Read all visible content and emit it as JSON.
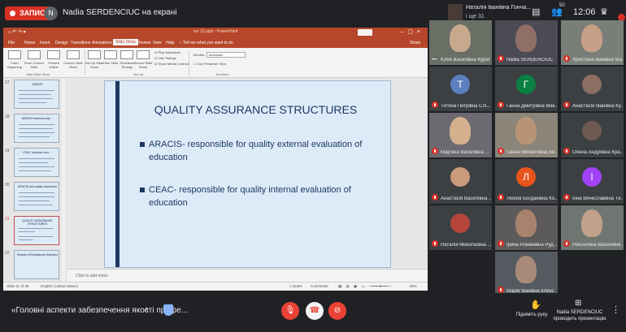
{
  "topbar": {
    "rec_label": "ЗАПИС",
    "presenter_initial": "N",
    "presenter_title": "Nadia SERDENCIUC на екрані",
    "pinned_name": "Наталія Іванівна Гонча...",
    "pinned_sub": "і ще 31",
    "participants_count": "50",
    "time": "12:06"
  },
  "ppt": {
    "file_title": "ver 22.pptx - PowerPoint",
    "quick_access": "⌂ ↶ ↷ ▾",
    "tabs": [
      "File",
      "Home",
      "Insert",
      "Design",
      "Transitions",
      "Animations",
      "Slide Show",
      "Review",
      "View",
      "Help",
      "♀ Tell me what you want to do"
    ],
    "share": "Share",
    "active_tab_index": 6,
    "ribbon_buttons": [
      "From Beginning",
      "From Current Slide",
      "Present Online",
      "Custom Slide Show",
      "Set Up Slide Show",
      "Hide Slide",
      "Rehearse Timings",
      "Record Slide Show"
    ],
    "ribbon_checks": [
      "Play Narrations",
      "Use Timings",
      "Show Media Controls"
    ],
    "monitor_label": "Monitor:",
    "monitor_value": "Automatic",
    "presenter_view": "Use Presenter View",
    "groups": [
      "Start Slide Show",
      "Set Up",
      "Monitors"
    ],
    "thumbs": [
      {
        "num": "17",
        "title": "ARACIS"
      },
      {
        "num": "18",
        "title": "ARACIS functions and ..."
      },
      {
        "num": "19",
        "title": "CEAC functions and ..."
      },
      {
        "num": "20",
        "title": "ARACIS and quality assurance"
      },
      {
        "num": "21",
        "title": "QUALITY ASSURANCE STRUCTURES"
      },
      {
        "num": "22",
        "title": "Results of Educational Sciences"
      }
    ],
    "selected_thumb": 4,
    "slide": {
      "title": "QUALITY ASSURANCE STRUCTURES",
      "bullets": [
        "ARACIS- responsible for quality external evaluation of education",
        "CEAC- responsible for quality internal evaluation of education"
      ]
    },
    "notes_placeholder": "Click to add notes",
    "status_slide": "Slide 21 of 38",
    "status_lang": "English (United States)",
    "status_notes": "≡ Notes",
    "status_comments": "Comments",
    "status_zoom": "60%"
  },
  "participants": [
    {
      "name": "Юлія Василівна Курій",
      "kind": "video",
      "bg": "#6a6f66",
      "face": "#c9a98e",
      "menu": true
    },
    {
      "name": "Nadia SERDENCIUC",
      "kind": "video",
      "bg": "#4b4a55",
      "face": "#8f6f66",
      "menu": false
    },
    {
      "name": "Христина Іванівна Ма...",
      "kind": "video",
      "bg": "#7a7e78",
      "face": "#c79e86",
      "menu": false
    },
    {
      "name": "Тетяна Петрівна Слі...",
      "kind": "letter",
      "letter": "Т",
      "color": "#5b7fbf",
      "menu": false
    },
    {
      "name": "Ганна Дмитрівна Мак...",
      "kind": "letter",
      "letter": "Г",
      "color": "#0b8043",
      "menu": false
    },
    {
      "name": "Анастасія Іванівна Ку...",
      "kind": "avatar",
      "bg": "#3c4043",
      "face": "#8c6e62",
      "menu": false
    },
    {
      "name": "Мар'яна Василівна ...",
      "kind": "video",
      "bg": "#6c6a70",
      "face": "#d4b08e",
      "menu": false
    },
    {
      "name": "Ганна Михайлівна Бе...",
      "kind": "video",
      "bg": "#8a8479",
      "face": "#b89477",
      "menu": false
    },
    {
      "name": "Олена Андріївна Кра...",
      "kind": "avatar",
      "bg": "#3c4043",
      "face": "#6d5a52",
      "menu": false
    },
    {
      "name": "Анастасія Василівна ...",
      "kind": "avatar",
      "bg": "#3c4043",
      "face": "#c99a7c",
      "menu": false
    },
    {
      "name": "Любов Богданівна Ко...",
      "kind": "letter",
      "letter": "Л",
      "color": "#e8541c",
      "menu": false
    },
    {
      "name": "Інна Вячеславівна Ти...",
      "kind": "letter",
      "letter": "І",
      "color": "#a142f4",
      "menu": false
    },
    {
      "name": "Наталія Миколаївна ...",
      "kind": "avatar",
      "bg": "#3c4043",
      "face": "#b5453a",
      "menu": false
    },
    {
      "name": "Ірина Романівна Руд...",
      "kind": "video",
      "bg": "#5d5a5c",
      "face": "#a9826d",
      "menu": false
    },
    {
      "name": "Роксоляна Василівна ...",
      "kind": "video",
      "bg": "#6f7571",
      "face": "#c2a089",
      "menu": false
    },
    {
      "name": "Марія Іванівна Клеус",
      "kind": "video",
      "bg": "#555a60",
      "face": "#a88a7a",
      "menu": false
    }
  ],
  "bottom": {
    "meeting_name": "«Головні аспекти забезпечення якості профе...",
    "raise_hand": "Підніміть руку",
    "presenter_line1": "Nadia SERDENCIUC",
    "presenter_line2": "проводить презентацію"
  },
  "icons": {
    "mic_off": "mic-off-icon",
    "end_call": "end-call-icon",
    "cam_off": "camera-off-icon",
    "hand": "raise-hand-icon",
    "present": "present-icon",
    "more": "more-vert-icon"
  },
  "colors": {
    "ppt_red": "#b7472a",
    "meet_red": "#ea4335",
    "slide_bg": "#dcebf7",
    "slide_text": "#1f3864"
  }
}
